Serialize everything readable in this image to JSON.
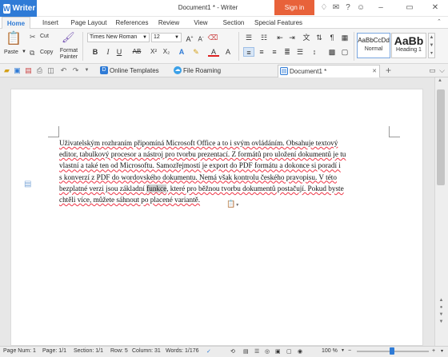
{
  "app": {
    "menu_name": "Writer",
    "logo_letter": "W",
    "window_title": "Document1 * - Writer",
    "signin": "Sign in"
  },
  "menu_tabs": [
    "Home",
    "Insert",
    "Page Layout",
    "References",
    "Review",
    "View",
    "Section",
    "Special Features"
  ],
  "ribbon": {
    "paste": "Paste",
    "cut": "Cut",
    "copy": "Copy",
    "format_painter_line1": "Format",
    "format_painter_line2": "Painter",
    "font_name": "Times New Roman",
    "font_size": "12",
    "styles": [
      {
        "sample": "AaBbCcDd",
        "label": "Normal"
      },
      {
        "sample": "AaBb",
        "label": "Heading 1"
      }
    ]
  },
  "doc_tabs": [
    {
      "label": "Online Templates"
    },
    {
      "label": "File Roaming"
    },
    {
      "label": "Document1 *"
    }
  ],
  "document": {
    "paragraph_lines": [
      "Uživatelským rozhraním připomíná Microsoft Office a to i svým ovládáním. Obsahuje textový",
      "editor, tabulkový procesor a nástroj pro tvorbu prezentací. Z formátů pro uložení dokumentů je tu",
      "vlastní a také ten od Microsoftu. Samozřejmostí je export do PDF formátu a dokonce si poradí i",
      "s konverzí z PDF do wordovského dokumentu. Nemá však kontrolu českého pravopisu. V této",
      "bezplatné verzi jsou základní ",
      "funkce",
      ", které pro běžnou tvorbu dokumentů postačují. Pokud byste",
      "chtěli více, můžete sáhnout po placené variantě."
    ]
  },
  "status": {
    "page_num": "Page Num: 1",
    "page": "Page: 1/1",
    "section": "Section: 1/1",
    "row": "Row: 5",
    "column": "Column: 31",
    "words": "Words: 1/176",
    "zoom": "100 %"
  },
  "colors": {
    "accent": "#2f7bd6",
    "signin": "#e8623a"
  }
}
